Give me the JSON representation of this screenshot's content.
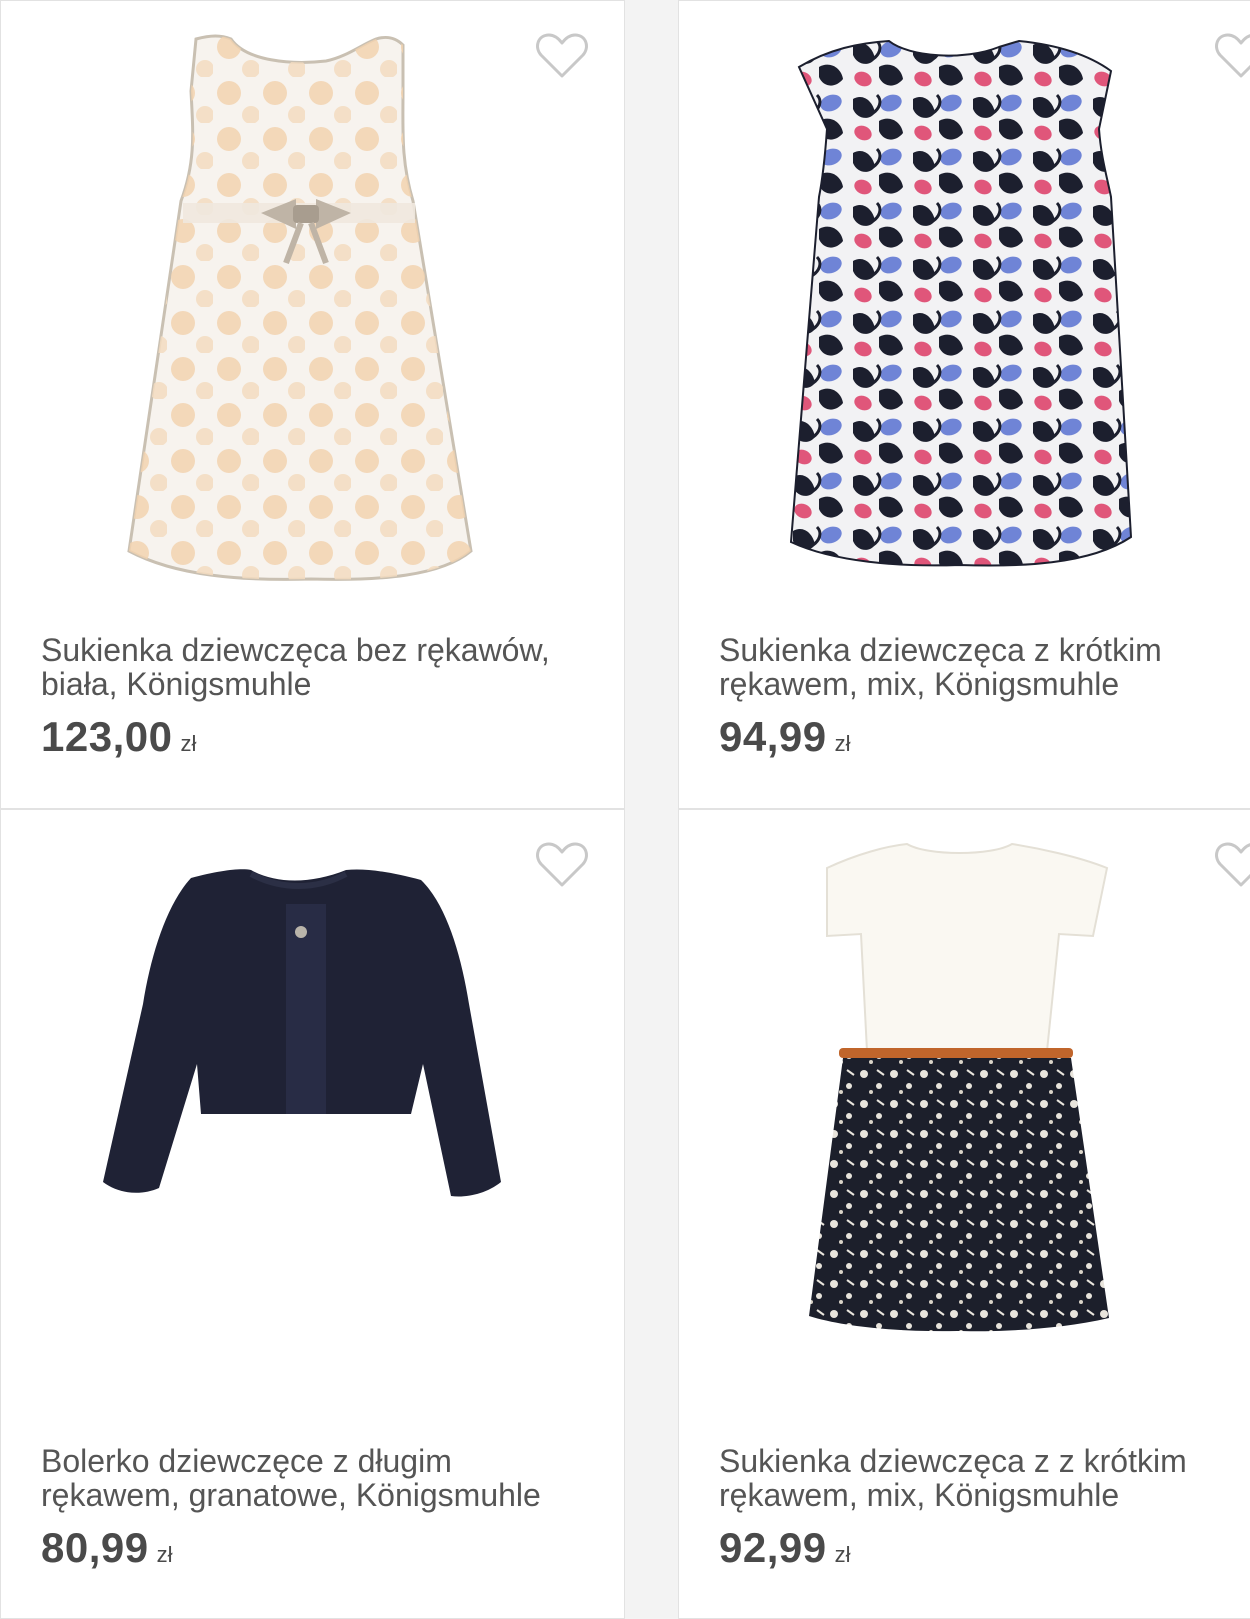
{
  "colors": {
    "background": "#f3f3f3",
    "card": "#ffffff",
    "title_text": "#555555",
    "price_text": "#4a4a4a",
    "heart_outline": "#c8c8c8"
  },
  "products": [
    {
      "title_line1": "Sukienka dziewczęca bez rękawów,",
      "title_line2": "biała, Königsmuhle",
      "price": "123,00",
      "currency": "zł",
      "favorite_icon": "heart-outline-icon"
    },
    {
      "title_line1": "Sukienka dziewczęca z krótkim",
      "title_line2": "rękawem, mix, Königsmuhle",
      "price": "94,99",
      "currency": "zł",
      "favorite_icon": "heart-outline-icon"
    },
    {
      "title_line1": "Bolerko dziewczęce z długim",
      "title_line2": "rękawem, granatowe, Königsmuhle",
      "price": "80,99",
      "currency": "zł",
      "favorite_icon": "heart-outline-icon"
    },
    {
      "title_line1": "Sukienka dziewczęca z z krótkim",
      "title_line2": "rękawem, mix, Königsmuhle",
      "price": "92,99",
      "currency": "zł",
      "favorite_icon": "heart-outline-icon"
    }
  ]
}
